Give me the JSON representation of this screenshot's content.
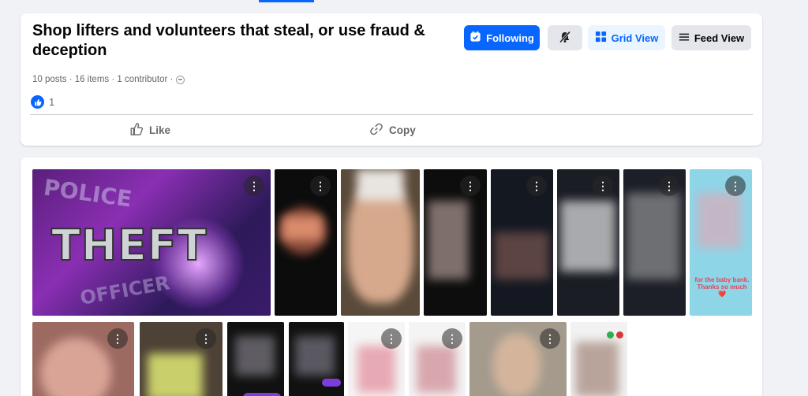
{
  "collection": {
    "title": "Shop lifters and volunteers that steal, or use fraud & deception",
    "meta": "10 posts · 16 items · 1 contributor ·",
    "reaction_count": "1"
  },
  "header_buttons": {
    "following_label": "Following",
    "grid_label": "Grid View",
    "feed_label": "Feed View"
  },
  "actions": {
    "like_label": "Like",
    "copy_label": "Copy"
  },
  "thumbnails": {
    "theft_image": {
      "main_text": "THEFT",
      "top_text": "POLICE",
      "bottom_text": "OFFICER"
    },
    "caption_baby_bank": "for the baby bank. Thanks so much ❤️"
  },
  "colors": {
    "accent": "#0866ff",
    "page_bg": "#f0f2f5"
  },
  "icons": [
    "following-check-icon",
    "mute-bell-icon",
    "grid-icon",
    "feed-icon",
    "like-thumb-icon",
    "copy-link-icon",
    "globe-icon",
    "more-dots-icon"
  ]
}
